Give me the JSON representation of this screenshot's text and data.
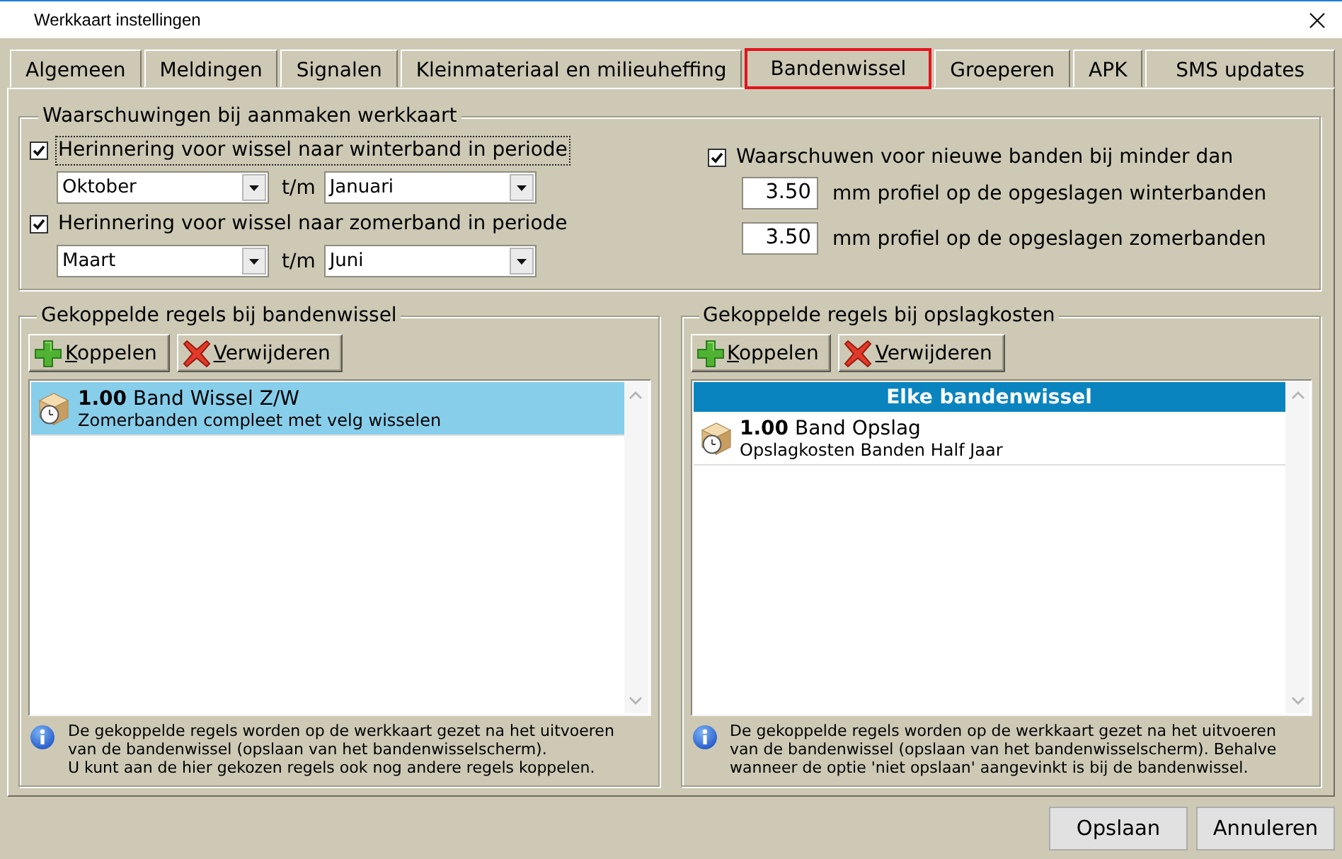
{
  "window": {
    "title": "Werkkaart instellingen"
  },
  "tabs": [
    {
      "label": "Algemeen",
      "selected": false
    },
    {
      "label": "Meldingen",
      "selected": false
    },
    {
      "label": "Signalen",
      "selected": false
    },
    {
      "label": "Kleinmateriaal en milieuheffing",
      "selected": false
    },
    {
      "label": "Bandenwissel",
      "selected": true
    },
    {
      "label": "Groeperen",
      "selected": false
    },
    {
      "label": "APK",
      "selected": false
    },
    {
      "label": "SMS updates",
      "selected": false
    }
  ],
  "warnings": {
    "title": "Waarschuwingen bij aanmaken werkkaart",
    "reminders": [
      {
        "label": "Herinnering voor wissel naar winterband in periode",
        "checked": true,
        "focused": true,
        "from": "Oktober",
        "separator": "t/m",
        "to": "Januari"
      },
      {
        "label": "Herinnering voor wissel naar zomerband in periode",
        "checked": true,
        "focused": false,
        "from": "Maart",
        "separator": "t/m",
        "to": "Juni"
      }
    ],
    "tread_warning": {
      "label": "Waarschuwen voor nieuwe banden bij minder dan",
      "checked": true,
      "focused": false,
      "thresholds": [
        {
          "value": "3.50",
          "label": "mm profiel op de opgeslagen winterbanden"
        },
        {
          "value": "3.50",
          "label": "mm profiel op de opgeslagen zomerbanden"
        }
      ]
    }
  },
  "linked_groups": [
    {
      "title": "Gekoppelde regels bij bandenwissel",
      "buttons": [
        {
          "kind": "add",
          "label": "Koppelen"
        },
        {
          "kind": "remove",
          "label": "Verwijderen"
        }
      ],
      "sections": [
        {
          "items": [
            {
              "title": "**1.00** Band Wissel Z/W",
              "description": "Zomerbanden compleet met velg wisselen",
              "selected": true
            }
          ]
        }
      ],
      "note": [
        "De gekoppelde regels worden op de werkkaart gezet na het uitvoeren van de bandenwissel (opslaan van het bandenwisselscherm).",
        "U kunt aan de hier gekozen regels ook nog andere regels koppelen."
      ]
    },
    {
      "title": "Gekoppelde regels bij opslagkosten",
      "buttons": [
        {
          "kind": "add",
          "label": "Koppelen"
        },
        {
          "kind": "remove",
          "label": "Verwijderen"
        }
      ],
      "sections": [
        {
          "header": "Elke bandenwissel",
          "items": [
            {
              "title": "**1.00** Band Opslag",
              "description": "Opslagkosten Banden Half Jaar",
              "selected": false
            }
          ]
        }
      ],
      "note": [
        "De gekoppelde regels worden op de werkkaart gezet na het uitvoeren van de bandenwissel (opslaan van het bandenwisselscherm). Behalve wanneer de optie 'niet opslaan' aangevinkt is bij de bandenwissel."
      ]
    }
  ],
  "footer_buttons": [
    {
      "label": "Opslaan"
    },
    {
      "label": "Annuleren"
    }
  ]
}
